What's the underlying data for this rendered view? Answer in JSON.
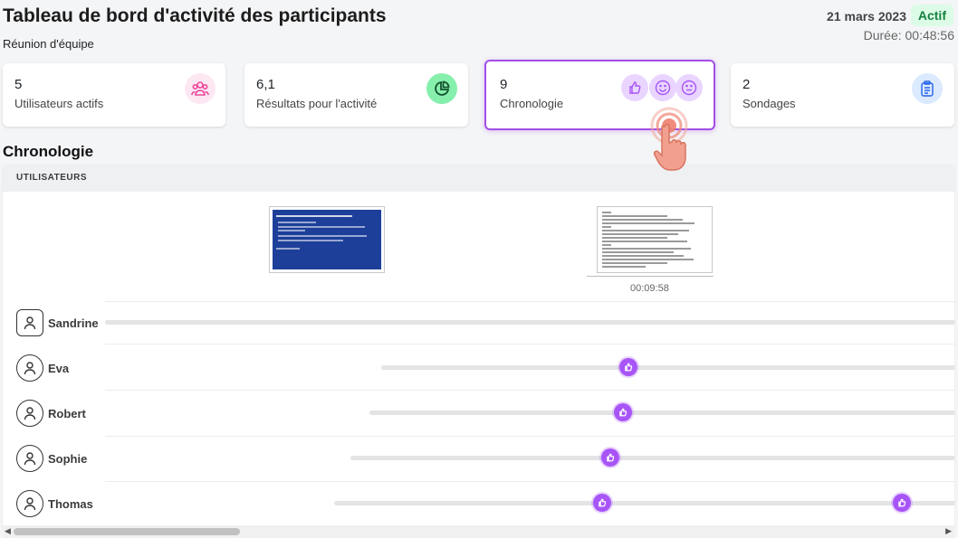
{
  "header": {
    "title": "Tableau de bord d'activité des participants",
    "subtitle": "Réunion d'équipe",
    "date": "21 mars 2023",
    "status": "Actif",
    "duration": "Durée: 00:48:56"
  },
  "stats": [
    {
      "value": "5",
      "label": "Utilisateurs actifs",
      "icon": "users-icon",
      "color": "#f472b6"
    },
    {
      "value": "6,1",
      "label": "Résultats pour l'activité",
      "icon": "pie-chart-icon",
      "color": "#16a34a"
    },
    {
      "value": "9",
      "label": "Chronologie",
      "icon": "reactions-icon",
      "color": "#a855f7"
    },
    {
      "value": "2",
      "label": "Sondages",
      "icon": "clipboard-icon",
      "color": "#3b82f6"
    }
  ],
  "timeline": {
    "title": "Chronologie",
    "column_header": "UTILISATEURS",
    "slide_time": "00:09:58",
    "users": [
      {
        "name": "Sandrine"
      },
      {
        "name": "Eva"
      },
      {
        "name": "Robert"
      },
      {
        "name": "Sophie"
      },
      {
        "name": "Thomas"
      }
    ]
  },
  "colors": {
    "accent": "#a855f7",
    "active_border": "#a34ee6",
    "status_bg": "#dcfce7",
    "status_text": "#15803d"
  }
}
